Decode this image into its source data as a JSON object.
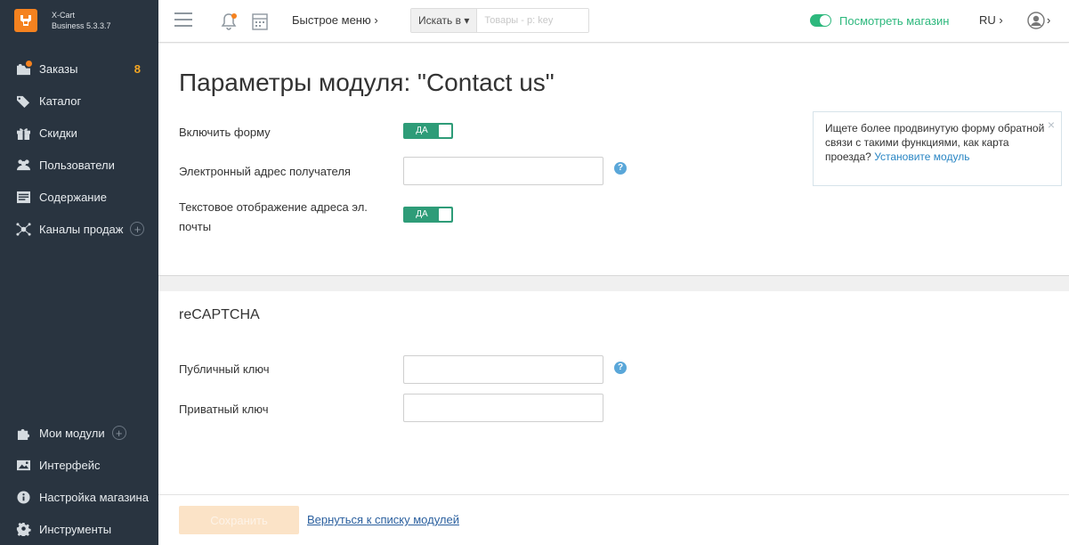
{
  "app": {
    "logo_line1": "X-Cart",
    "logo_line2": "Business 5.3.3.7"
  },
  "sidebar": {
    "items": [
      {
        "label": "Заказы",
        "icon": "orders-icon",
        "badge": "8"
      },
      {
        "label": "Каталог",
        "icon": "tags-icon"
      },
      {
        "label": "Скидки",
        "icon": "gift-icon"
      },
      {
        "label": "Пользователи",
        "icon": "users-icon"
      },
      {
        "label": "Содержание",
        "icon": "content-icon"
      },
      {
        "label": "Каналы продаж",
        "icon": "sales-channels-icon",
        "plus": "+"
      },
      {
        "label": "Мои модули",
        "icon": "puzzle-icon",
        "plus": "+"
      },
      {
        "label": "Интерфейс",
        "icon": "image-icon"
      },
      {
        "label": "Настройка магазина",
        "icon": "info-icon"
      },
      {
        "label": "Инструменты",
        "icon": "gear-icon"
      }
    ]
  },
  "topbar": {
    "quick_menu": "Быстрое меню ›",
    "search_type": "Искать в ▾",
    "search_placeholder": "Товары - p: key",
    "store_link": "Посмотреть магазин",
    "language": "RU ›",
    "user_chevron": "›"
  },
  "main": {
    "title": "Параметры модуля: \"Contact us\"",
    "fields": {
      "enable_form_label": "Включить форму",
      "enable_form_value": "ДА",
      "recipient_email_label": "Электронный адрес получателя",
      "recipient_email_value": "",
      "text_email_label_line1": "Текстовое отображение адреса эл.",
      "text_email_label_line2": "почты",
      "text_email_value": "ДА"
    },
    "promo": {
      "text": "Ищете более продвинутую форму обратной связи с такими функциями, как карта проезда?",
      "link": "Установите модуль",
      "close": "×"
    },
    "recaptcha": {
      "title": "reCAPTCHA",
      "public_key_label": "Публичный ключ",
      "public_key_value": "",
      "private_key_label": "Приватный ключ",
      "private_key_value": ""
    },
    "help_glyph": "?"
  },
  "footer": {
    "save_label": "Сохранить",
    "back_link": "Вернуться к списку модулей"
  },
  "colors": {
    "sidebar_bg": "#293440",
    "accent_orange": "#f5821f",
    "toggle_green": "#2e9c78",
    "store_green": "#2db87d",
    "link_blue": "#2a86c4"
  }
}
